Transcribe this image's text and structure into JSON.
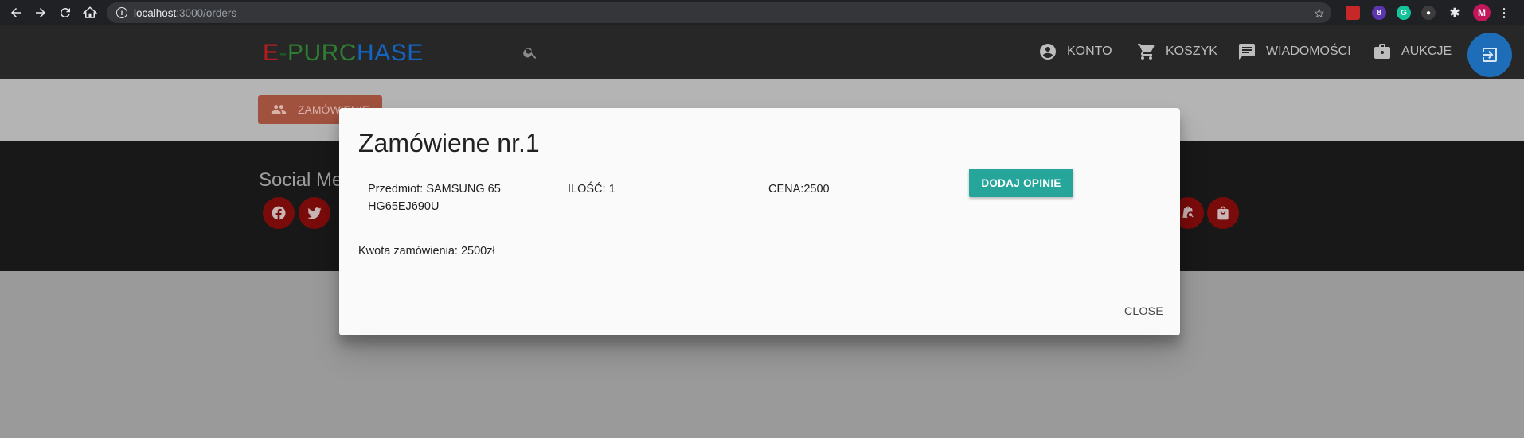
{
  "browser": {
    "url_host": "localhost",
    "url_path": ":3000/orders",
    "ext_badge": "8",
    "avatar_letter": "M"
  },
  "appbar": {
    "logo": [
      {
        "text": "E",
        "color": "#b71c1c"
      },
      {
        "text": "-",
        "color": "#1b5e20"
      },
      {
        "text": "PURC",
        "color": "#2e7d32"
      },
      {
        "text": "HASE",
        "color": "#1565c0"
      }
    ],
    "nav": {
      "account": "KONTO",
      "cart": "KOSZYK",
      "messages": "WIADOMOŚCI",
      "auctions": "AUKCJE"
    }
  },
  "page": {
    "orders_button": "ZAMÓWIENIE",
    "social_title": "Social Me"
  },
  "dialog": {
    "title": "Zamówiene nr.1",
    "item_line1": "Przedmiot: SAMSUNG 65",
    "item_line2": "HG65EJ690U",
    "quantity": "ILOŚĆ: 1",
    "price": "CENA:2500",
    "review_button": "DODAJ OPINIE",
    "total": "Kwota zamówienia: 2500zł",
    "close_button": "CLOSE"
  },
  "colors": {
    "accent_teal": "#26a69a",
    "fab_blue": "#1e6db8",
    "social_red": "#7a0b0b"
  }
}
